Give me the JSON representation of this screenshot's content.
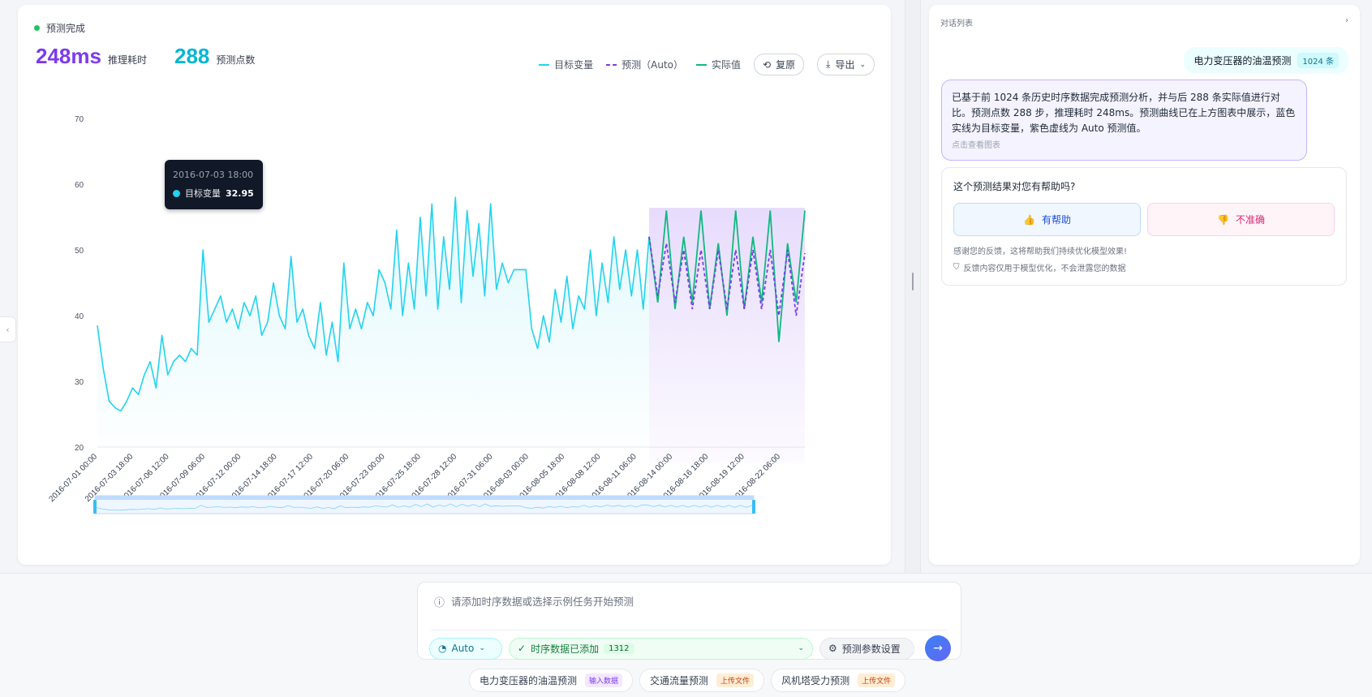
{
  "status": {
    "text": "预测完成"
  },
  "metrics": {
    "latency": {
      "value": "248ms",
      "label": "推理耗时"
    },
    "points": {
      "value": "288",
      "label": "预测点数"
    }
  },
  "legend": {
    "target": "目标变量",
    "pred": "预测（Auto）",
    "actual": "实际值"
  },
  "toolbar": {
    "reset": "复原",
    "export": "导出"
  },
  "tooltip": {
    "time": "2016-07-03 18:00",
    "series": "目标变量",
    "value": "32.95"
  },
  "colors": {
    "target": "#22d3ee",
    "pred": "#7c3aed",
    "actual": "#10b981"
  },
  "chart_data": {
    "type": "line",
    "ylim": [
      20,
      70
    ],
    "yticks": [
      "20",
      "30",
      "40",
      "50",
      "60",
      "70"
    ],
    "x_ticks": [
      "2016-07-01 00:00",
      "2016-07-03 18:00",
      "2016-07-06 12:00",
      "2016-07-09 06:00",
      "2016-07-12 00:00",
      "2016-07-14 18:00",
      "2016-07-17 12:00",
      "2016-07-20 06:00",
      "2016-07-23 00:00",
      "2016-07-25 18:00",
      "2016-07-28 12:00",
      "2016-07-31 06:00",
      "2016-08-03 00:00",
      "2016-08-05 18:00",
      "2016-08-08 12:00",
      "2016-08-11 06:00",
      "2016-08-14 00:00",
      "2016-08-16 18:00",
      "2016-08-19 12:00",
      "2016-08-22 06:00"
    ],
    "series": [
      {
        "name": "目标变量",
        "values": [
          38.5,
          32,
          27,
          26,
          25.5,
          27,
          29,
          28,
          31,
          33,
          29,
          37,
          31,
          33,
          34,
          33,
          35,
          34,
          50,
          39,
          41,
          43,
          39,
          41,
          38,
          42,
          40,
          43,
          37,
          39,
          45,
          40,
          38,
          49,
          39,
          41,
          37,
          35,
          42,
          34,
          39,
          33,
          48,
          38,
          41,
          38,
          42,
          40,
          47,
          45,
          41,
          53,
          40,
          48,
          41,
          55,
          43,
          57,
          41,
          52,
          44,
          58,
          42,
          56,
          46,
          54,
          43,
          57,
          44,
          48,
          45,
          47,
          47,
          47,
          38,
          35,
          40,
          36,
          44,
          39,
          46,
          38,
          43,
          41,
          50,
          40,
          48,
          42,
          52,
          44,
          50,
          43,
          50,
          41,
          52
        ],
        "x_start": 0.0,
        "x_end": 1.0
      },
      {
        "name": "预测（Auto）",
        "values": [
          52,
          43,
          51,
          42,
          50,
          41,
          50,
          41,
          50,
          41,
          50,
          41,
          50,
          41,
          50,
          40,
          50,
          40,
          49.5
        ]
      },
      {
        "name": "实际值",
        "values": [
          52,
          42,
          56,
          41,
          52,
          42,
          56,
          41,
          51,
          40,
          56,
          41,
          52,
          42,
          56,
          36,
          51,
          42,
          56
        ]
      }
    ]
  },
  "chat": {
    "title": "对话列表",
    "user_msg": "电力变压器的油温预测",
    "user_badge": "1024 条",
    "ai_msg": "已基于前 1024 条历史时序数据完成预测分析，并与后 288 条实际值进行对比。预测点数 288 步，推理耗时 248ms。预测曲线已在上方图表中展示，蓝色实线为目标变量，紫色虚线为 Auto 预测值。",
    "ai_link": "点击查看图表",
    "feedback": {
      "question": "这个预测结果对您有帮助吗?",
      "good": "有帮助",
      "bad": "不准确",
      "note": "感谢您的反馈，这将帮助我们持续优化模型效果!",
      "privacy": "反馈内容仅用于模型优化，不会泄露您的数据"
    }
  },
  "input": {
    "placeholder": "请添加时序数据或选择示例任务开始预测",
    "model": "Auto",
    "data_status": "时序数据已添加",
    "data_count": "1312",
    "settings": "预测参数设置"
  },
  "examples": [
    {
      "label": "电力变压器的油温预测",
      "tag": "输入数据"
    },
    {
      "label": "交通流量预测",
      "tag": "上传文件"
    },
    {
      "label": "风机塔受力预测",
      "tag": "上传文件"
    }
  ]
}
